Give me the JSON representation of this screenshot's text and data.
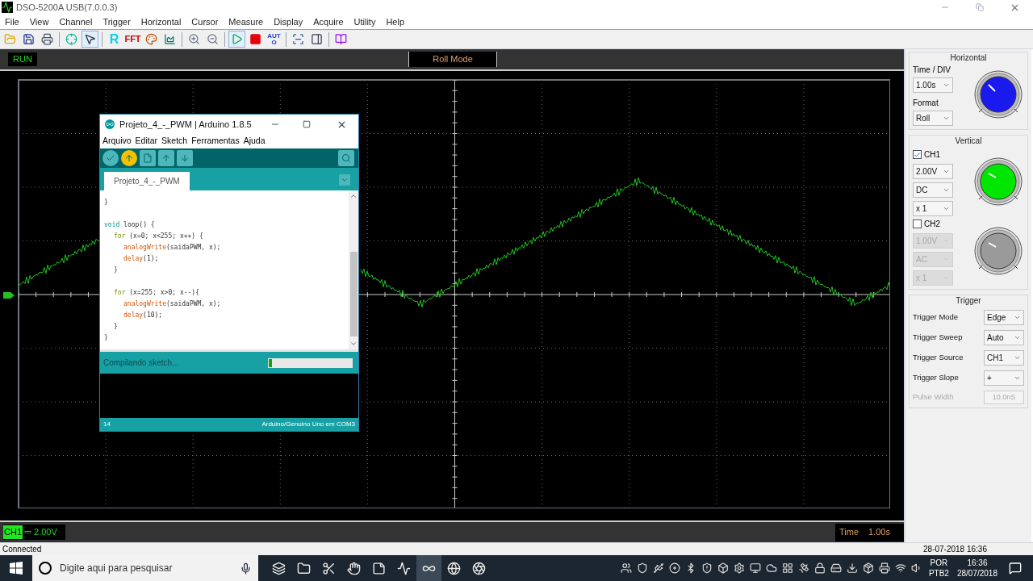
{
  "window": {
    "title": "DSO-5200A USB(7.0.0.3)"
  },
  "menu": [
    "File",
    "View",
    "Channel",
    "Trigger",
    "Horizontal",
    "Cursor",
    "Measure",
    "Display",
    "Acquire",
    "Utility",
    "Help"
  ],
  "toolbar": [
    [
      {
        "pressed": false
      },
      {
        "pressed": false
      },
      {
        "pressed": false
      }
    ],
    [
      {
        "pressed": false
      },
      {
        "pressed": true
      }
    ],
    [
      {
        "text": "R",
        "pressed": false
      },
      {
        "text": "FFT",
        "pressed": false
      },
      {
        "pressed": false
      },
      {
        "pressed": false
      }
    ],
    [
      {
        "pressed": false
      },
      {
        "pressed": false
      }
    ],
    [
      {
        "pressed": true
      },
      {
        "pressed": false
      },
      {
        "text": "AUTO",
        "pressed": false
      }
    ],
    [
      {
        "pressed": false
      },
      {
        "pressed": false
      }
    ],
    [
      {
        "pressed": false
      }
    ]
  ],
  "scope": {
    "run_status": "RUN",
    "mode": "Roll Mode",
    "channel_badge": "CH1",
    "channel_reading": "⎓ 2.00V",
    "time_label": "Time",
    "time_value": "1.00s"
  },
  "arduino": {
    "title": "Projeto_4_-_PWM | Arduino 1.8.5",
    "menu": [
      "Arquivo",
      "Editar",
      "Sketch",
      "Ferramentas",
      "Ajuda"
    ],
    "tools": [
      {
        "active": false
      },
      {
        "active": true
      },
      {
        "active": false
      },
      {
        "active": false
      },
      {
        "active": false
      }
    ],
    "tab": "Projeto_4_-_PWM",
    "code": [
      {
        "segments": [
          {
            "kind": "plain",
            "text": "}"
          }
        ]
      },
      {
        "gap_before": true,
        "segments": [
          {
            "kind": "type",
            "text": "void"
          },
          {
            "kind": "plain",
            "text": " loop() {"
          }
        ],
        "children": [
          {
            "segments": [
              {
                "kind": "keyword",
                "text": "for"
              },
              {
                "kind": "plain",
                "text": " (x=0; x<255; x++) {"
              }
            ],
            "children": [
              {
                "segments": [
                  {
                    "kind": "function",
                    "text": "analogWrite"
                  },
                  {
                    "kind": "plain",
                    "text": "(saidaPWM, x);"
                  }
                ]
              },
              {
                "segments": [
                  {
                    "kind": "function",
                    "text": "delay"
                  },
                  {
                    "kind": "plain",
                    "text": "(1);"
                  }
                ]
              }
            ]
          },
          {
            "segments": [
              {
                "kind": "plain",
                "text": "}"
              }
            ]
          },
          {
            "gap_before": true,
            "segments": [
              {
                "kind": "keyword",
                "text": "for"
              },
              {
                "kind": "plain",
                "text": " (x=255; x>0; x--){"
              }
            ],
            "children": [
              {
                "segments": [
                  {
                    "kind": "function",
                    "text": "analogWrite"
                  },
                  {
                    "kind": "plain",
                    "text": "(saidaPWM, x);"
                  }
                ]
              },
              {
                "segments": [
                  {
                    "kind": "function",
                    "text": "delay"
                  },
                  {
                    "kind": "plain",
                    "text": "(10);"
                  }
                ]
              }
            ]
          },
          {
            "segments": [
              {
                "kind": "plain",
                "text": "}"
              }
            ]
          }
        ]
      },
      {
        "segments": [
          {
            "kind": "plain",
            "text": "}"
          }
        ]
      }
    ],
    "status": "Compilando sketch...",
    "progress": {
      "level": 0.04
    },
    "line_number": "14",
    "board": "Arduino/Genuino Uno em COM3"
  },
  "horizontal": {
    "title": "Horizontal",
    "time_div_label": "Time / DIV",
    "time_div": "1.00s",
    "format_label": "Format",
    "format": "Roll"
  },
  "vertical": {
    "title": "Vertical",
    "channels": [
      {
        "name": "CH1",
        "checked": true,
        "color": "#00e600",
        "settings": [
          "2.00V",
          "DC",
          "x 1"
        ]
      },
      {
        "name": "CH2",
        "checked": false,
        "color": "#9a9a9a",
        "settings": [
          "1.00V",
          "AC",
          "x 1"
        ]
      }
    ]
  },
  "trigger": {
    "title": "Trigger",
    "rows": [
      {
        "kind": "select",
        "label": "Trigger Mode",
        "value": "Edge",
        "disabled": false
      },
      {
        "kind": "select",
        "label": "Trigger Sweep",
        "value": "Auto",
        "disabled": false
      },
      {
        "kind": "select",
        "label": "Trigger Source",
        "value": "CH1",
        "disabled": false
      },
      {
        "kind": "select",
        "label": "Trigger Slope",
        "value": "+",
        "disabled": false
      },
      {
        "kind": "field",
        "label": "Pulse Width",
        "value": "10.0nS",
        "disabled": true
      }
    ]
  },
  "status_bar": {
    "left": "Connected",
    "right": "28-07-2018 16:36"
  },
  "taskbar": {
    "search_placeholder": "Digite aqui para pesquisar",
    "apps": [
      {
        "selected": false
      },
      {
        "selected": false
      },
      {
        "selected": false
      },
      {
        "selected": false
      },
      {
        "selected": false
      },
      {
        "selected": false
      },
      {
        "selected": true
      },
      {
        "selected": false
      },
      {
        "selected": false
      }
    ],
    "language": "POR",
    "layout": "PTB2",
    "time": "16:36",
    "date": "28/07/2018"
  }
}
